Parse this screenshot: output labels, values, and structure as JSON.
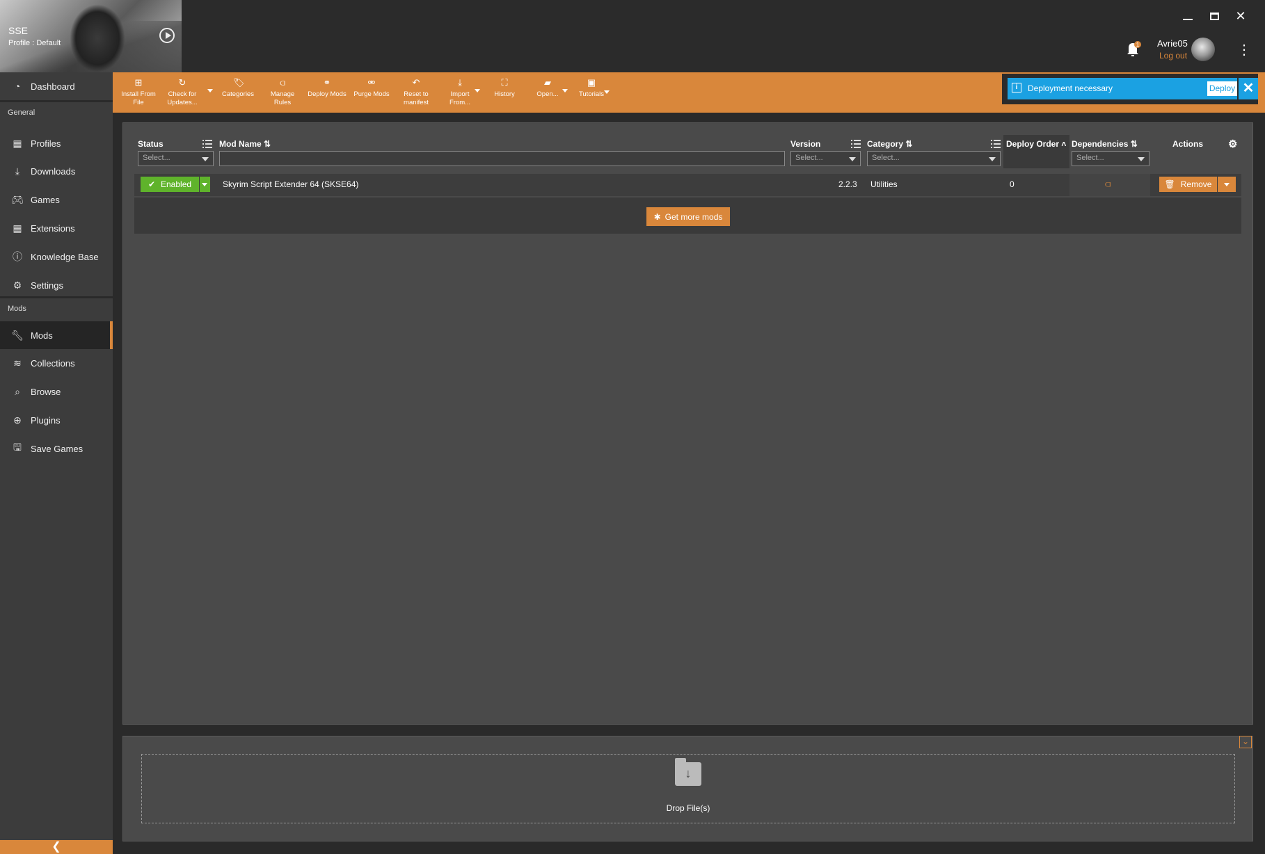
{
  "window": {
    "minimize": "🗕",
    "maximize": "🗖",
    "close": "✕"
  },
  "game": {
    "short_name": "SSE",
    "profile": "Profile : Default"
  },
  "user": {
    "name": "Avrie05",
    "logout": "Log out",
    "notification_count": "1"
  },
  "sidebar": {
    "items_top": [
      {
        "label": "Dashboard",
        "icon": "dashboard-icon"
      }
    ],
    "general_header": "General",
    "general_items": [
      {
        "label": "Profiles",
        "icon": "profiles-icon"
      },
      {
        "label": "Downloads",
        "icon": "download-icon"
      },
      {
        "label": "Games",
        "icon": "gamepad-icon"
      },
      {
        "label": "Extensions",
        "icon": "extensions-icon"
      },
      {
        "label": "Knowledge Base",
        "icon": "info-icon"
      },
      {
        "label": "Settings",
        "icon": "gear-icon"
      }
    ],
    "mods_header": "Mods",
    "mods_items": [
      {
        "label": "Mods",
        "icon": "wrench-icon",
        "active": true
      },
      {
        "label": "Collections",
        "icon": "layers-icon"
      },
      {
        "label": "Browse",
        "icon": "search-icon"
      },
      {
        "label": "Plugins",
        "icon": "plus-circle-icon"
      },
      {
        "label": "Save Games",
        "icon": "save-icon"
      }
    ]
  },
  "toolbar": {
    "install_from_file": [
      "Install From",
      "File"
    ],
    "check_for_updates": [
      "Check for",
      "Updates..."
    ],
    "categories": "Categories",
    "manage_rules": [
      "Manage",
      "Rules"
    ],
    "deploy_mods": "Deploy Mods",
    "purge_mods": "Purge Mods",
    "reset_to_manifest": [
      "Reset to",
      "manifest"
    ],
    "import_from": [
      "Import",
      "From..."
    ],
    "history": "History",
    "open": "Open...",
    "tutorials": "Tutorials"
  },
  "notification": {
    "text": "Deployment necessary",
    "action": "Deploy"
  },
  "table": {
    "columns": {
      "status": "Status",
      "mod_name": "Mod Name",
      "version": "Version",
      "category": "Category",
      "deploy_order": "Deploy Order",
      "dependencies": "Dependencies",
      "actions": "Actions"
    },
    "filter_placeholder": "Select...",
    "rows": [
      {
        "status": "Enabled",
        "name": "Skyrim Script Extender 64 (SKSE64)",
        "version": "2.2.3",
        "category": "Utilities",
        "deploy_order": "0",
        "action": "Remove"
      }
    ],
    "get_more": "Get more mods"
  },
  "dropzone": {
    "text": "Drop File(s)"
  },
  "colors": {
    "accent": "#d9873b",
    "info": "#1ba1e2",
    "enabled": "#5fb32b"
  }
}
